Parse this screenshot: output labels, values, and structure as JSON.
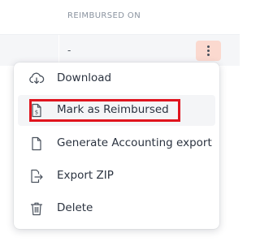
{
  "table": {
    "column_header": "REIMBURSED ON",
    "row_value": "-"
  },
  "row_actions": {
    "button_icon": "kebab-menu-icon",
    "button_color": "#fbd9cf"
  },
  "menu": {
    "items": [
      {
        "label": "Download",
        "icon": "cloud-download-icon"
      },
      {
        "label": "Mark as Reimbursed",
        "icon": "receipt-dollar-icon",
        "highlighted": true
      },
      {
        "label": "Generate Accounting export",
        "icon": "document-icon"
      },
      {
        "label": "Export ZIP",
        "icon": "file-export-icon"
      },
      {
        "label": "Delete",
        "icon": "trash-icon"
      }
    ]
  },
  "colors": {
    "highlight_outline": "#e0141e",
    "text": "#2b3340",
    "header_text": "#8a939f"
  }
}
